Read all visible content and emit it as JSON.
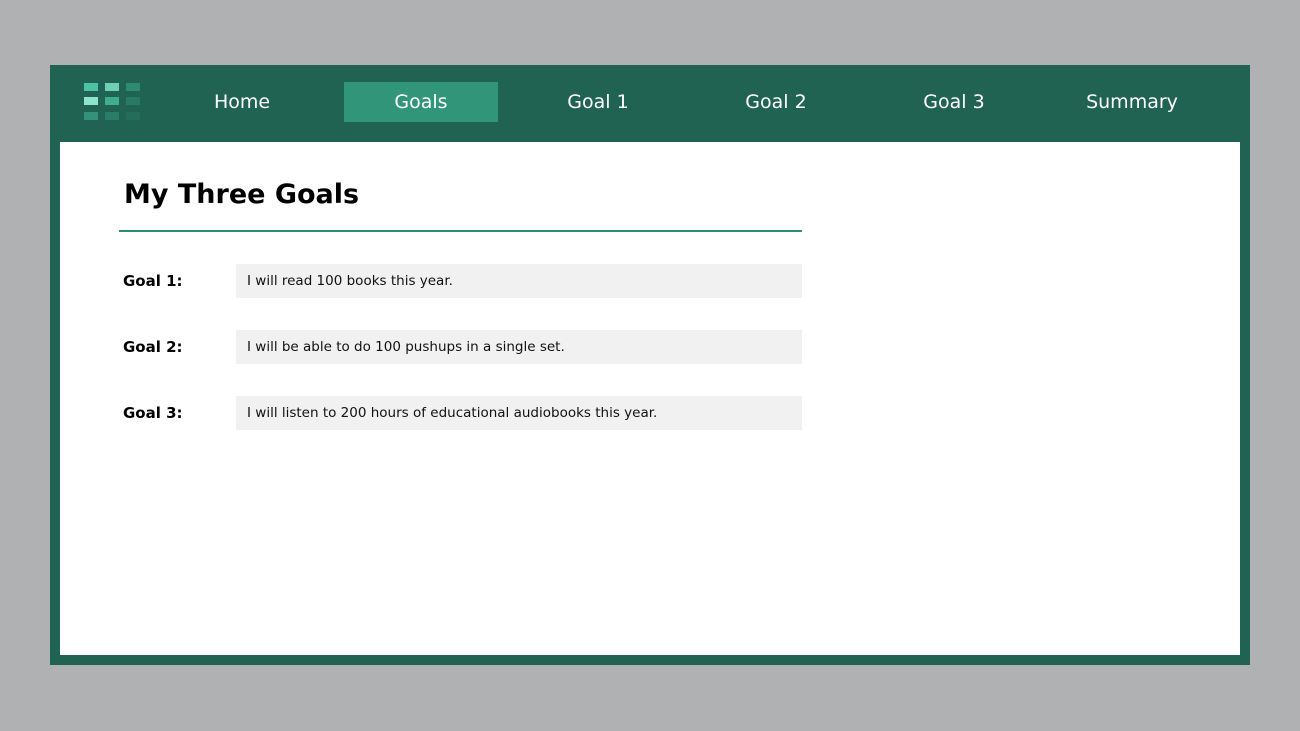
{
  "logo": {
    "icon": "grid-logo-icon",
    "cell_colors": [
      [
        "#4cc4a3",
        "#6fd0b5",
        "#2f8a72"
      ],
      [
        "#8fe3cd",
        "#3fae8f",
        "#287a64"
      ],
      [
        "#35917a",
        "#2b7c67",
        "#256d5b"
      ]
    ]
  },
  "nav": {
    "items": [
      {
        "label": "Home",
        "active": false
      },
      {
        "label": "Goals",
        "active": true
      },
      {
        "label": "Goal 1",
        "active": false
      },
      {
        "label": "Goal 2",
        "active": false
      },
      {
        "label": "Goal 3",
        "active": false
      },
      {
        "label": "Summary",
        "active": false
      }
    ]
  },
  "page": {
    "title": "My Three Goals",
    "goals": [
      {
        "label": "Goal 1:",
        "value": "I will read 100 books this year."
      },
      {
        "label": "Goal 2:",
        "value": "I will be able to do 100 pushups in a single set."
      },
      {
        "label": "Goal 3:",
        "value": "I will listen to 200 hours of educational audiobooks this year."
      }
    ]
  },
  "colors": {
    "frame": "#216353",
    "active_tab": "#31957a",
    "rule": "#2e8c73",
    "field_bg": "#f1f1f1",
    "backdrop": "#b0b1b3"
  }
}
